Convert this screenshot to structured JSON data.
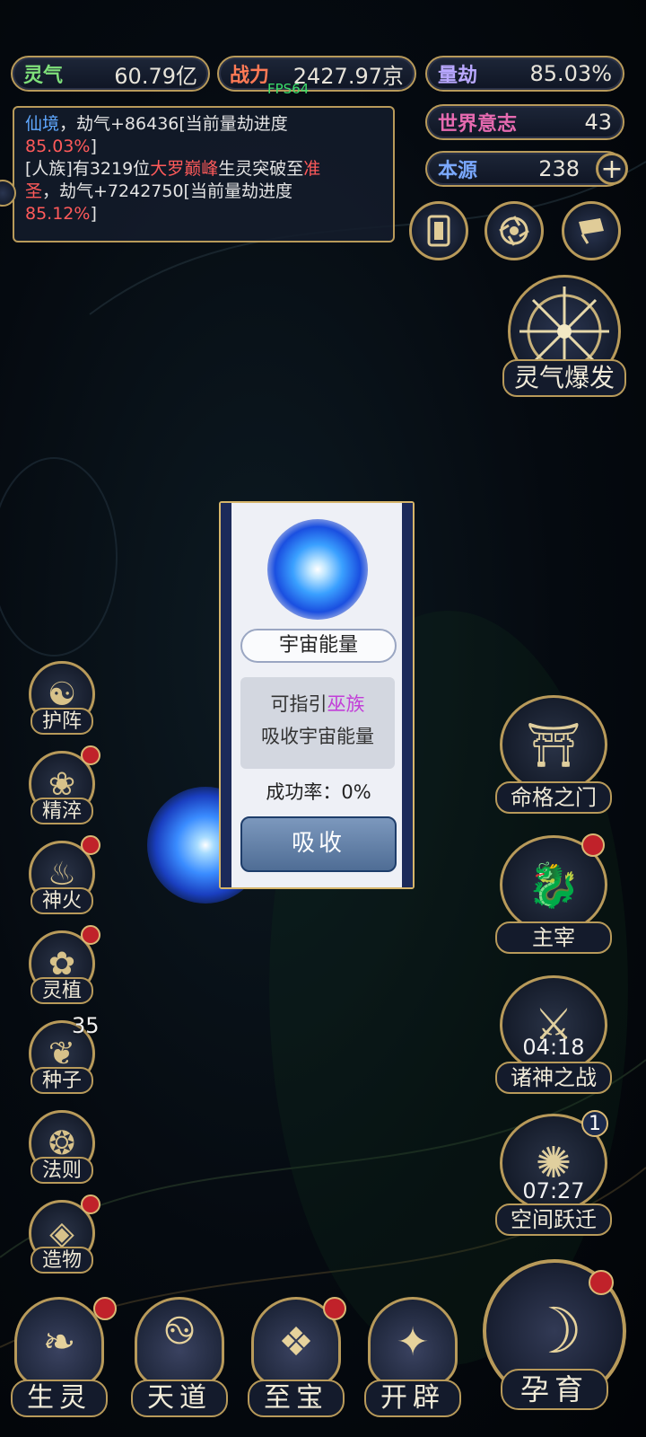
{
  "top_stats": {
    "lingqi_label": "灵气",
    "lingqi_value": "60.79亿",
    "zhanli_label": "战力",
    "zhanli_value": "2427.97京",
    "liangjie_label": "量劫",
    "liangjie_value": "85.03%",
    "shijie_label": "世界意志",
    "shijie_value": "43",
    "benyuan_label": "本源",
    "benyuan_value": "238",
    "fps": "FPS64"
  },
  "log": {
    "line1_a": "仙境",
    "line1_b": "，劫气+86436[当前量劫进度",
    "line1_c": "85.03%",
    "line1_d": "]",
    "line2_a": "[人族]有3219位",
    "line2_b": "大罗巅峰",
    "line2_c": "生灵突破至",
    "line2_d": "准",
    "line3_a": "圣",
    "line3_b": "，劫气+7242750[当前量劫进度",
    "line4_a": "85.12%",
    "line4_b": "]"
  },
  "popup": {
    "title": "宇宙能量",
    "desc_1a": "可指引",
    "desc_1b": "巫族",
    "desc_2": "吸收宇宙能量",
    "rate": "成功率：0%",
    "button": "吸收"
  },
  "right_top": {
    "burst": "灵气爆发"
  },
  "left_buttons": [
    {
      "label": "护阵"
    },
    {
      "label": "精淬"
    },
    {
      "label": "神火"
    },
    {
      "label": "灵植"
    },
    {
      "label": "种子",
      "badge": "35"
    },
    {
      "label": "法则"
    },
    {
      "label": "造物"
    }
  ],
  "right_buttons": [
    {
      "label": "命格之门"
    },
    {
      "label": "主宰"
    },
    {
      "label": "诸神之战",
      "timer": "04:18"
    },
    {
      "label": "空间跃迁",
      "timer": "07:27",
      "badge": "1"
    }
  ],
  "bottom_buttons": [
    {
      "label": "生灵"
    },
    {
      "label": "天道"
    },
    {
      "label": "至宝"
    },
    {
      "label": "开辟"
    },
    {
      "label": "孕育"
    }
  ],
  "colors": {
    "gold_border": "#b89a5a",
    "red_dot": "#c0222a",
    "popup_bg": "#eef0f6",
    "accent_purple": "#c23ed8"
  }
}
